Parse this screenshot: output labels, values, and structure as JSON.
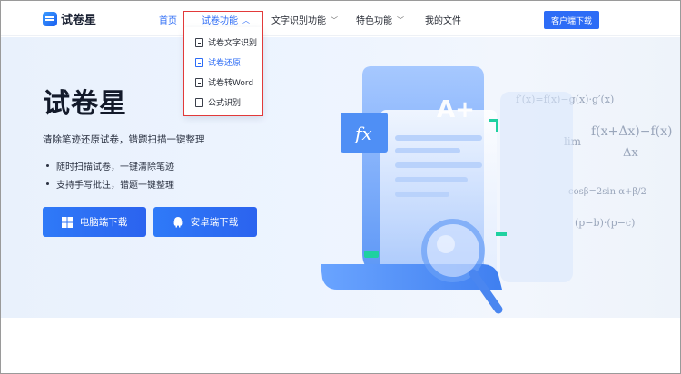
{
  "brand": {
    "name": "试卷星"
  },
  "nav": {
    "items": [
      {
        "label": "首页",
        "active": true
      },
      {
        "label": "试卷功能",
        "expanded": true
      },
      {
        "label": "文字识别功能"
      },
      {
        "label": "特色功能"
      },
      {
        "label": "我的文件"
      }
    ],
    "cta": "客户端下载"
  },
  "dropdown": {
    "items": [
      {
        "label": "试卷文字识别"
      },
      {
        "label": "试卷还原",
        "selected": true
      },
      {
        "label": "试卷转Word"
      },
      {
        "label": "公式识别"
      }
    ]
  },
  "hero": {
    "title": "试卷星",
    "subtitle": "清除笔迹还原试卷，错题扫描一键整理",
    "bullets": [
      "随时扫描试卷，一键清除笔迹",
      "支持手写批注，错题一键整理"
    ],
    "buttons": {
      "pc": "电脑端下载",
      "android": "安卓端下载"
    }
  },
  "illustration": {
    "fx": "fx",
    "grade": "A+",
    "formulas": [
      "f′(x)=f(x)−g(x)·g′(x)",
      "f(x+Δx)−f(x)",
      "lim",
      "Δx",
      "cosβ=2sin α+β/2",
      "(p−b)·(p−c)"
    ]
  },
  "colors": {
    "accent": "#2d6cf6",
    "highlight": "#e23a3a"
  }
}
